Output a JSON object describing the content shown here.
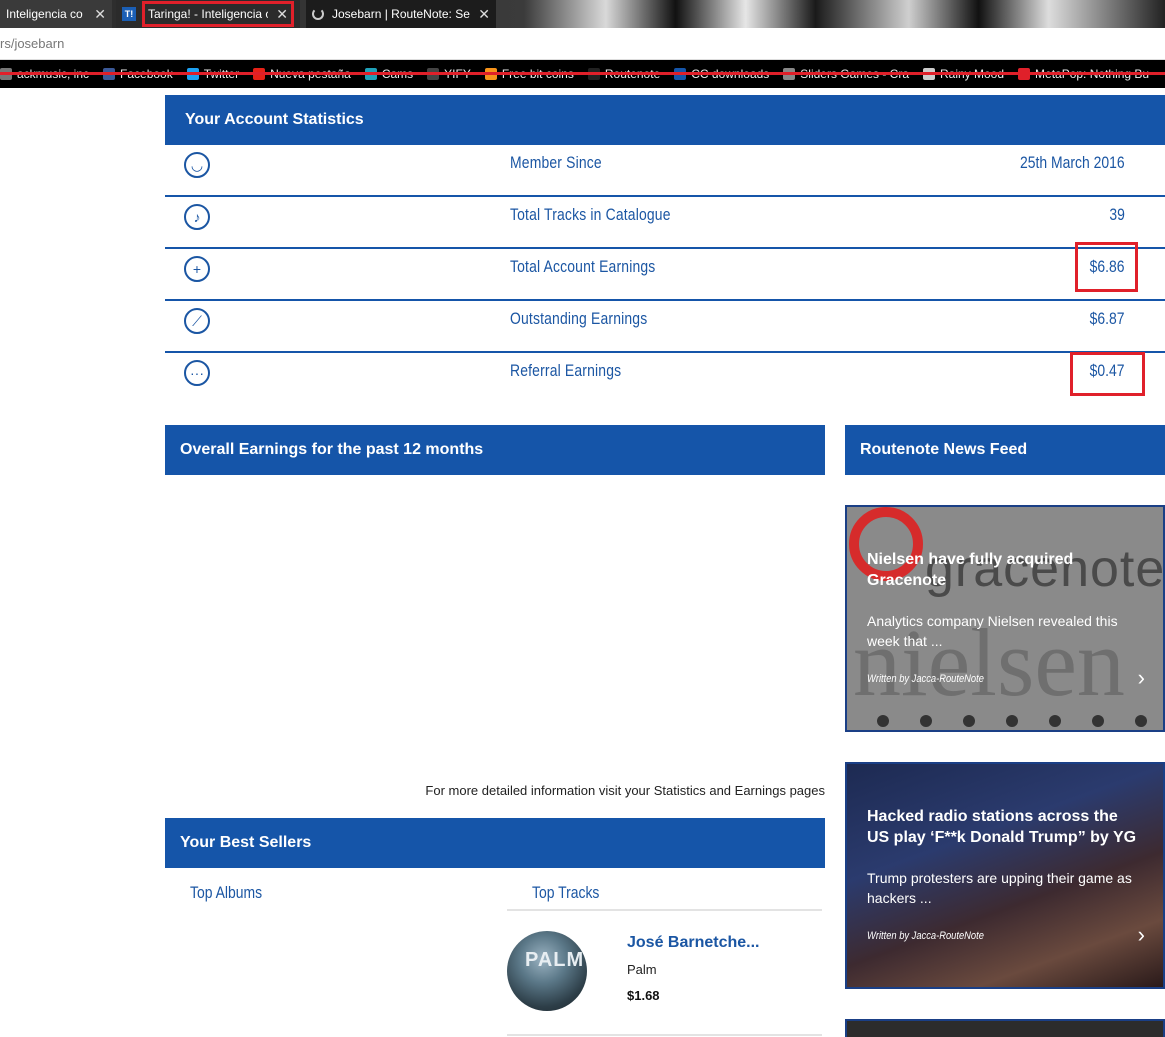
{
  "browser": {
    "tabs": [
      {
        "title": "Inteligencia co"
      },
      {
        "title": "Taringa! - Inteligencia co",
        "favicon": "T!"
      },
      {
        "title": "Josebarn | RouteNote: Se"
      }
    ],
    "url": "rs/josebarn",
    "bookmarks": [
      {
        "label": "ackmusic, inc",
        "color": "#777777"
      },
      {
        "label": "Facebook",
        "color": "#3b5998"
      },
      {
        "label": "Twitter",
        "color": "#1da1f2"
      },
      {
        "label": "Nueva pestaña",
        "color": "#e62117"
      },
      {
        "label": "Cams",
        "color": "#1fa0b8"
      },
      {
        "label": "YIFY",
        "color": "#444444"
      },
      {
        "label": "Free bit coins",
        "color": "#f7931a"
      },
      {
        "label": "Routenote",
        "color": "#222222"
      },
      {
        "label": "CC downloads",
        "color": "#1555a9"
      },
      {
        "label": "Sliders Games - Cra",
        "color": "#888888"
      },
      {
        "label": "Rainy Mood",
        "color": "#cccccc"
      },
      {
        "label": "MetaPop: Nothing Bu",
        "color": "#e0202a"
      }
    ]
  },
  "stats": {
    "heading": "Your Account Statistics",
    "rows": [
      {
        "icon": "user-icon",
        "glyph": "◡",
        "label": "Member Since",
        "value": "25th March 2016"
      },
      {
        "icon": "music-note-icon",
        "glyph": "♪",
        "label": "Total Tracks in Catalogue",
        "value": "39"
      },
      {
        "icon": "plus-circle-icon",
        "glyph": "+",
        "label": "Total Account Earnings",
        "value": "$6.86"
      },
      {
        "icon": "slash-circle-icon",
        "glyph": "⟋",
        "label": "Outstanding Earnings",
        "value": "$6.87"
      },
      {
        "icon": "chat-bubble-icon",
        "glyph": "···",
        "label": "Referral Earnings",
        "value": "$0.47"
      }
    ]
  },
  "earnings": {
    "heading": "Overall Earnings for the past 12 months",
    "more_info": "For more detailed information visit your Statistics and Earnings pages"
  },
  "news": {
    "heading": "Routenote News Feed",
    "items": [
      {
        "title": "Nielsen have fully acquired Gracenote",
        "excerpt": "Analytics company Nielsen revealed this week that ...",
        "author": "Written by Jacca-RouteNote",
        "image_text_1": "gracenote",
        "image_text_2": "nielsen"
      },
      {
        "title": "Hacked radio stations across the US play ‘F**k Donald Trump” by YG",
        "excerpt": "Trump protesters are upping their game as hackers ...",
        "author": "Written by Jacca-RouteNote"
      }
    ]
  },
  "best_sellers": {
    "heading": "Your Best Sellers",
    "top_albums_label": "Top Albums",
    "top_tracks_label": "Top Tracks",
    "tracks": [
      {
        "artist": "José Barnetche...",
        "title": "Palm",
        "price": "$1.68",
        "cover_text": "PALM"
      }
    ]
  },
  "colors": {
    "brand_blue": "#1555a9",
    "highlight_red": "#e0202a"
  }
}
